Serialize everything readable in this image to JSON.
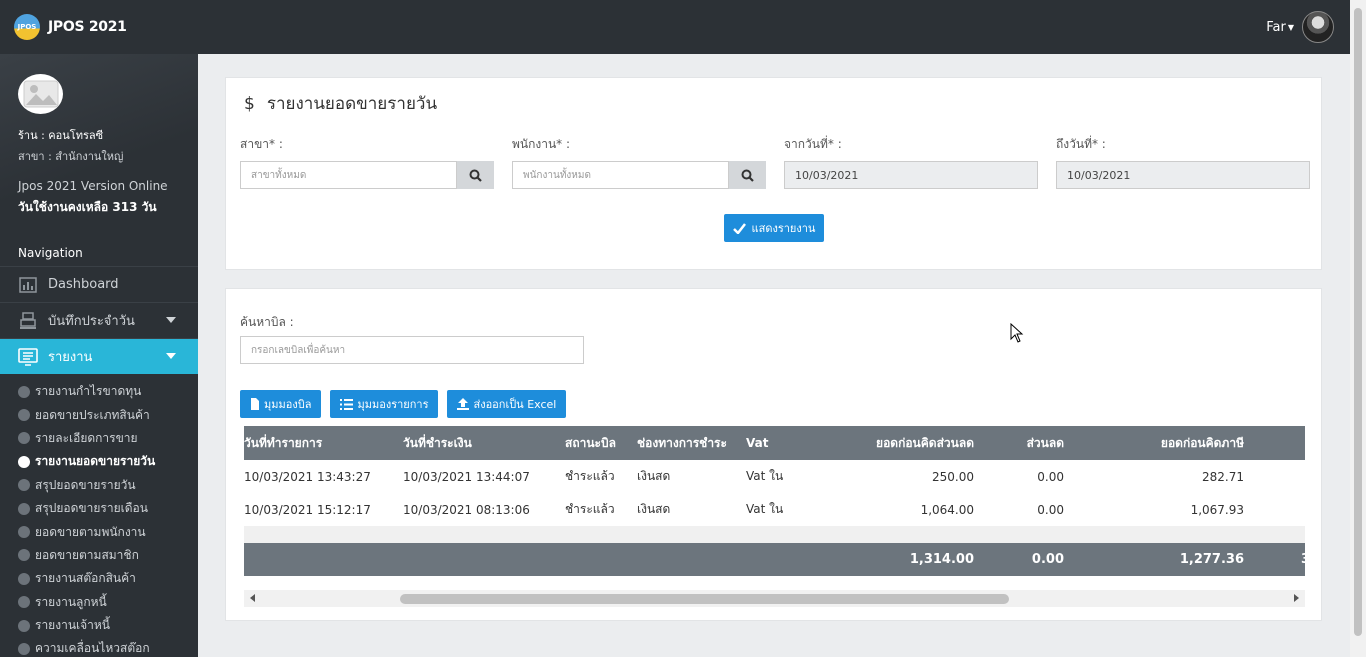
{
  "app": {
    "name": "JPOS 2021",
    "logo_text": "JPOS"
  },
  "user": {
    "name": "Far"
  },
  "sidebar": {
    "shop": "ร้าน : คอนโทรลซี",
    "branch": "สาขา : สำนักงานใหญ่",
    "version": "Jpos 2021 Version Online",
    "remaining": "วันใช้งานคงเหลือ 313 วัน",
    "nav_title": "Navigation",
    "items": [
      {
        "label": "Dashboard",
        "icon": "chart-icon"
      },
      {
        "label": "บันทึกประจำวัน",
        "icon": "register-icon"
      },
      {
        "label": "รายงาน",
        "icon": "report-icon"
      }
    ],
    "sub_items": [
      "รายงานกำไรขาดทุน",
      "ยอดขายประเภทสินค้า",
      "รายละเอียดการขาย",
      "รายงานยอดขายรายวัน",
      "สรุปยอดขายรายวัน",
      "สรุปยอดขายรายเดือน",
      "ยอดขายตามพนักงาน",
      "ยอดขายตามสมาชิก",
      "รายงานสต๊อกสินค้า",
      "รายงานลูกหนี้",
      "รายงานเจ้าหนี้",
      "ความเคลื่อนไหวสต๊อก"
    ]
  },
  "filter": {
    "title": "รายงานยอดขายรายวัน",
    "branch_label": "สาขา* :",
    "branch_placeholder": "สาขาทั้งหมด",
    "staff_label": "พนักงาน* :",
    "staff_placeholder": "พนักงานทั้งหมด",
    "from_label": "จากวันที่* :",
    "from_value": "10/03/2021",
    "to_label": "ถึงวันที่* :",
    "to_value": "10/03/2021",
    "show_button": "แสดงรายงาน"
  },
  "results": {
    "search_label": "ค้นหาบิล :",
    "search_placeholder": "กรอกเลขบิลเพื่อค้นหา",
    "buttons": {
      "bill_view": "มุมมองบิล",
      "item_view": "มุมมองรายการ",
      "export": "ส่งออกเป็น Excel"
    },
    "columns": [
      "วันที่ทำรายการ",
      "วันที่ชำระเงิน",
      "สถานะบิล",
      "ช่องทางการชำระ",
      "Vat",
      "ยอดก่อนคิดส่วนลด",
      "ส่วนลด",
      "ยอดก่อนคิดภาษี"
    ],
    "rows": [
      [
        "10/03/2021 13:43:27",
        "10/03/2021 13:44:07",
        "ชำระแล้ว",
        "เงินสด",
        "Vat ใน",
        "250.00",
        "0.00",
        "282.71"
      ],
      [
        "10/03/2021 15:12:17",
        "10/03/2021 08:13:06",
        "ชำระแล้ว",
        "เงินสด",
        "Vat ใน",
        "1,064.00",
        "0.00",
        "1,067.93"
      ]
    ],
    "totals": {
      "before_discount": "1,314.00",
      "discount": "0.00",
      "before_tax": "1,277.36",
      "next": "3"
    }
  }
}
